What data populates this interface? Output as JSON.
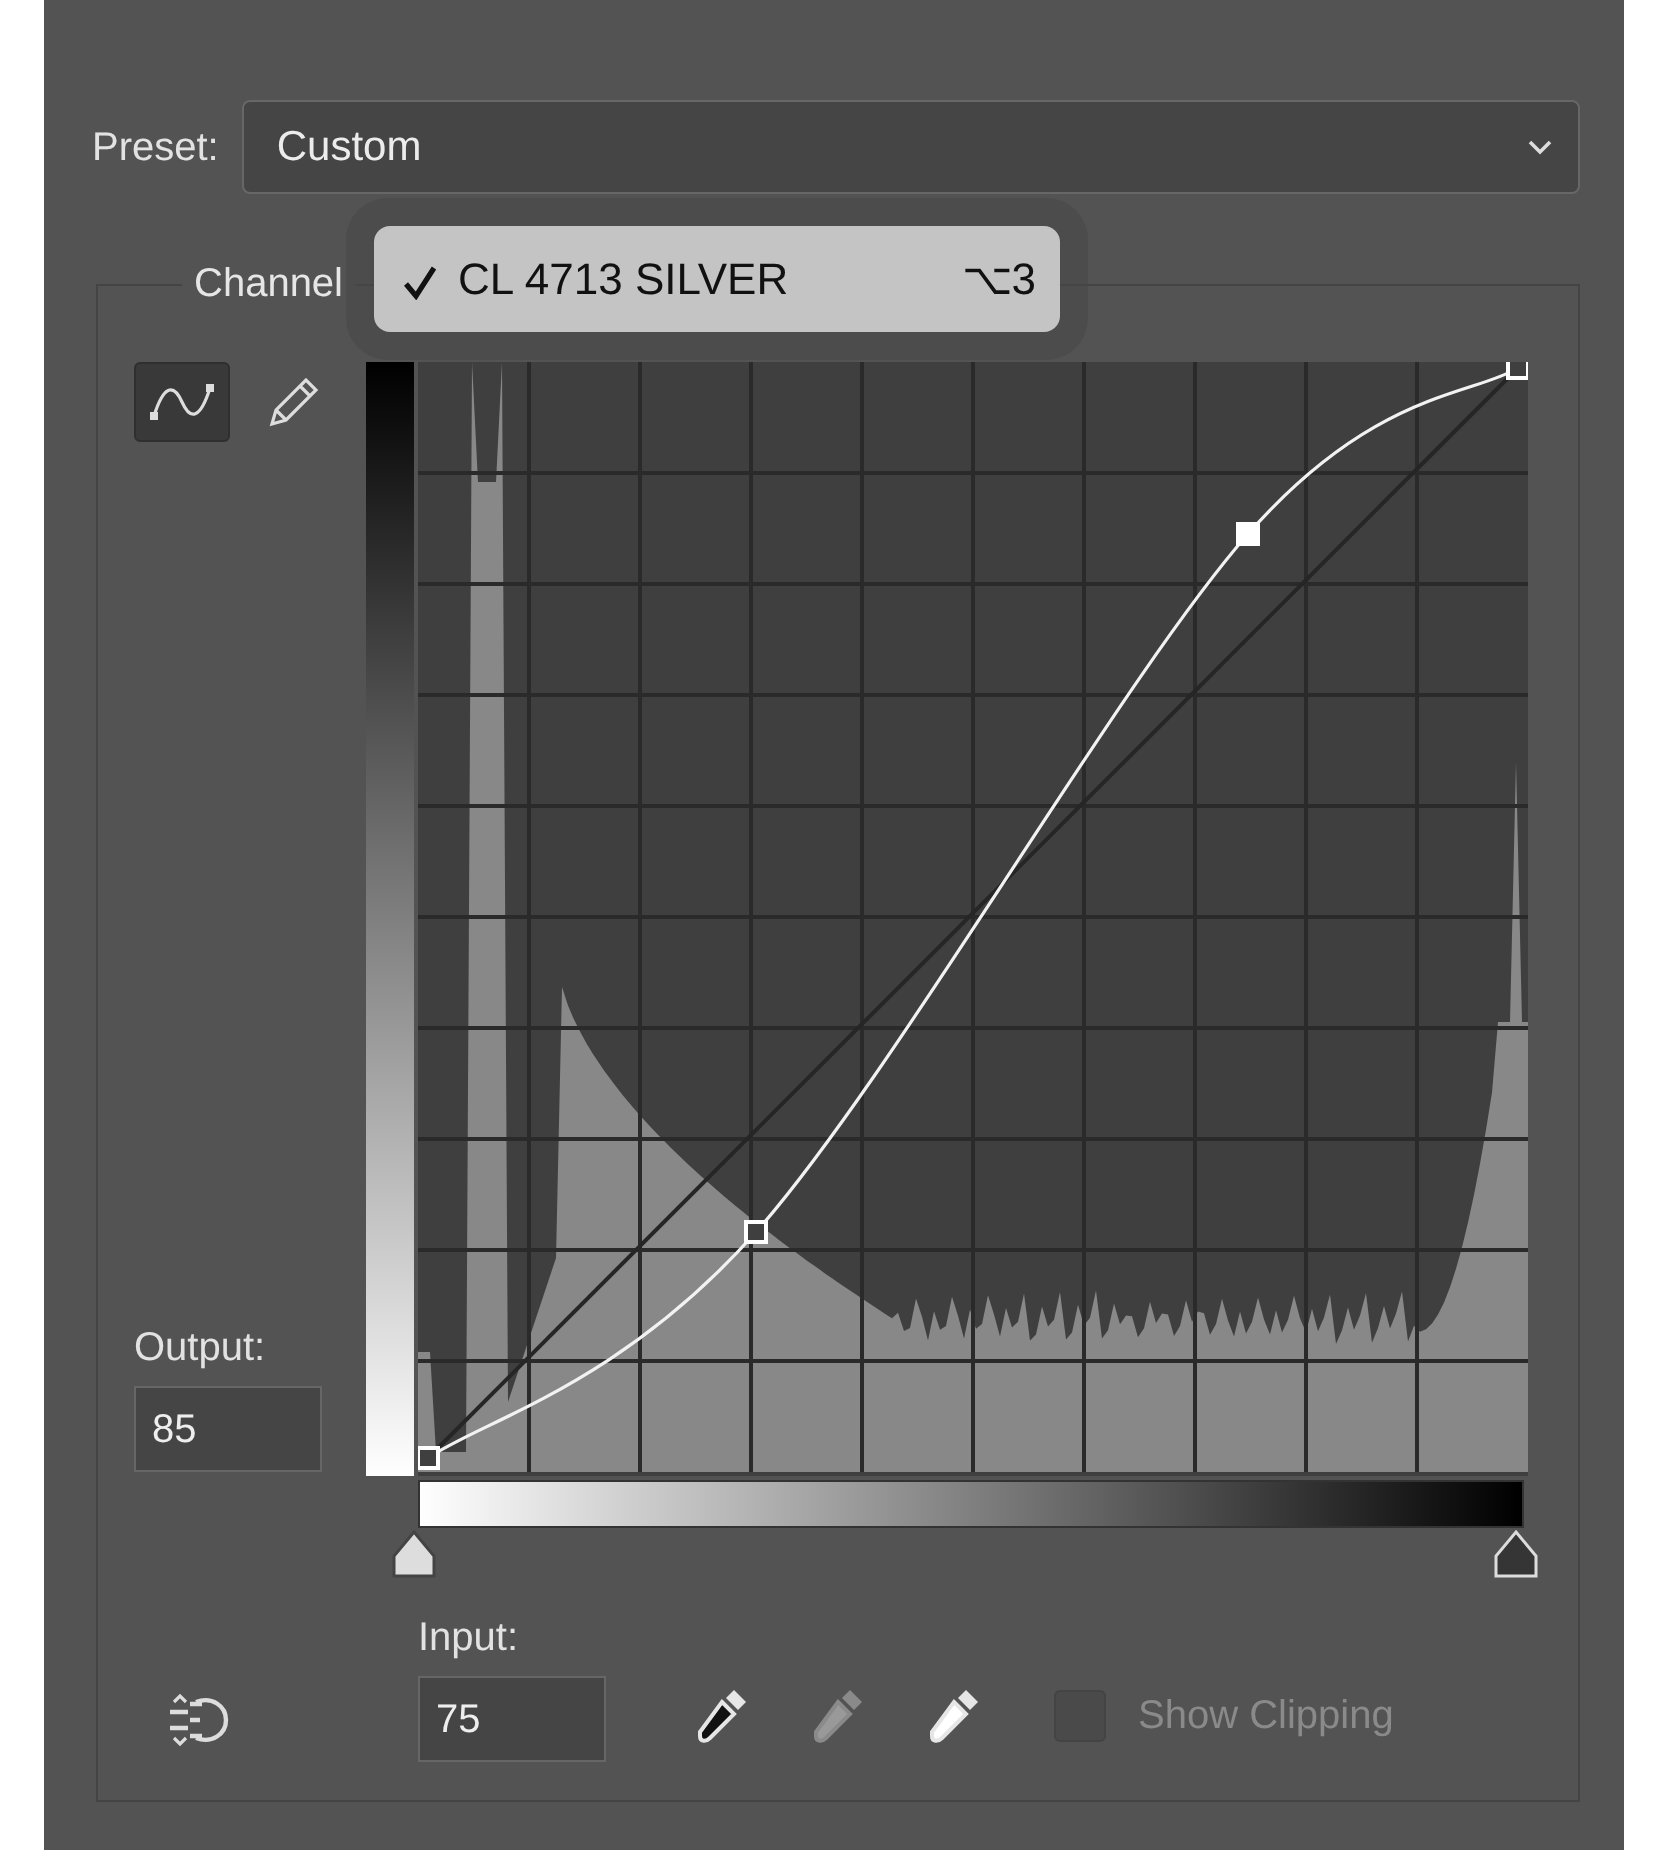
{
  "preset": {
    "label": "Preset:",
    "value": "Custom"
  },
  "channel_group": {
    "legend": "Channel"
  },
  "channel_menu": {
    "items": [
      {
        "label": "CL 4713 SILVER",
        "shortcut": "⌥3",
        "checked": true
      }
    ]
  },
  "tools": [
    {
      "kind": "curve",
      "selected": true
    },
    {
      "kind": "pencil",
      "selected": false
    }
  ],
  "curve_points": [
    {
      "selected": false
    },
    {
      "selected": false
    },
    {
      "selected": true
    },
    {
      "selected": false
    }
  ],
  "output": {
    "label": "Output:",
    "value": "85"
  },
  "input": {
    "label": "Input:",
    "value": "75"
  },
  "eyedroppers": [
    {
      "kind": "black"
    },
    {
      "kind": "gray"
    },
    {
      "kind": "white"
    }
  ],
  "show_clipping": {
    "label": "Show Clipping",
    "checked": false,
    "disabled": true
  }
}
